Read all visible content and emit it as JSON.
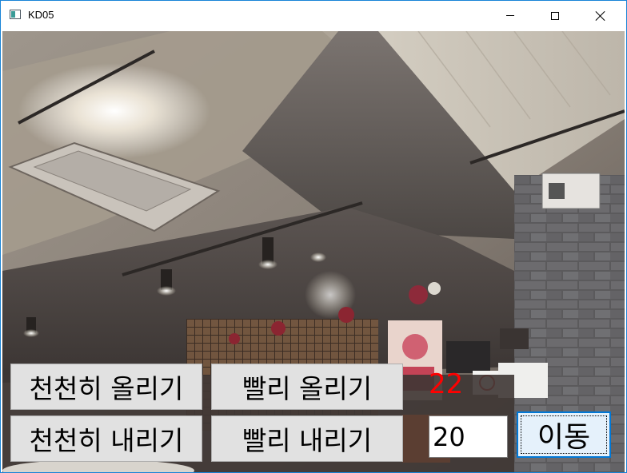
{
  "window": {
    "title": "KD05",
    "controls": {
      "minimize": "minimize-icon",
      "maximize": "maximize-icon",
      "close": "close-icon"
    }
  },
  "camera_feed": {
    "description_icon": "camera-view"
  },
  "controls": {
    "slow_up_label": "천천히 올리기",
    "fast_up_label": "빨리 올리기",
    "slow_down_label": "천천히 내리기",
    "fast_down_label": "빨리 내리기",
    "current_position": "22",
    "target_position_value": "20",
    "move_label": "이동"
  },
  "colors": {
    "position_text": "#ff0000",
    "focused_button_border": "#0078d7",
    "focused_button_bg": "#e5f1fb",
    "button_bg": "#e1e1e1"
  }
}
